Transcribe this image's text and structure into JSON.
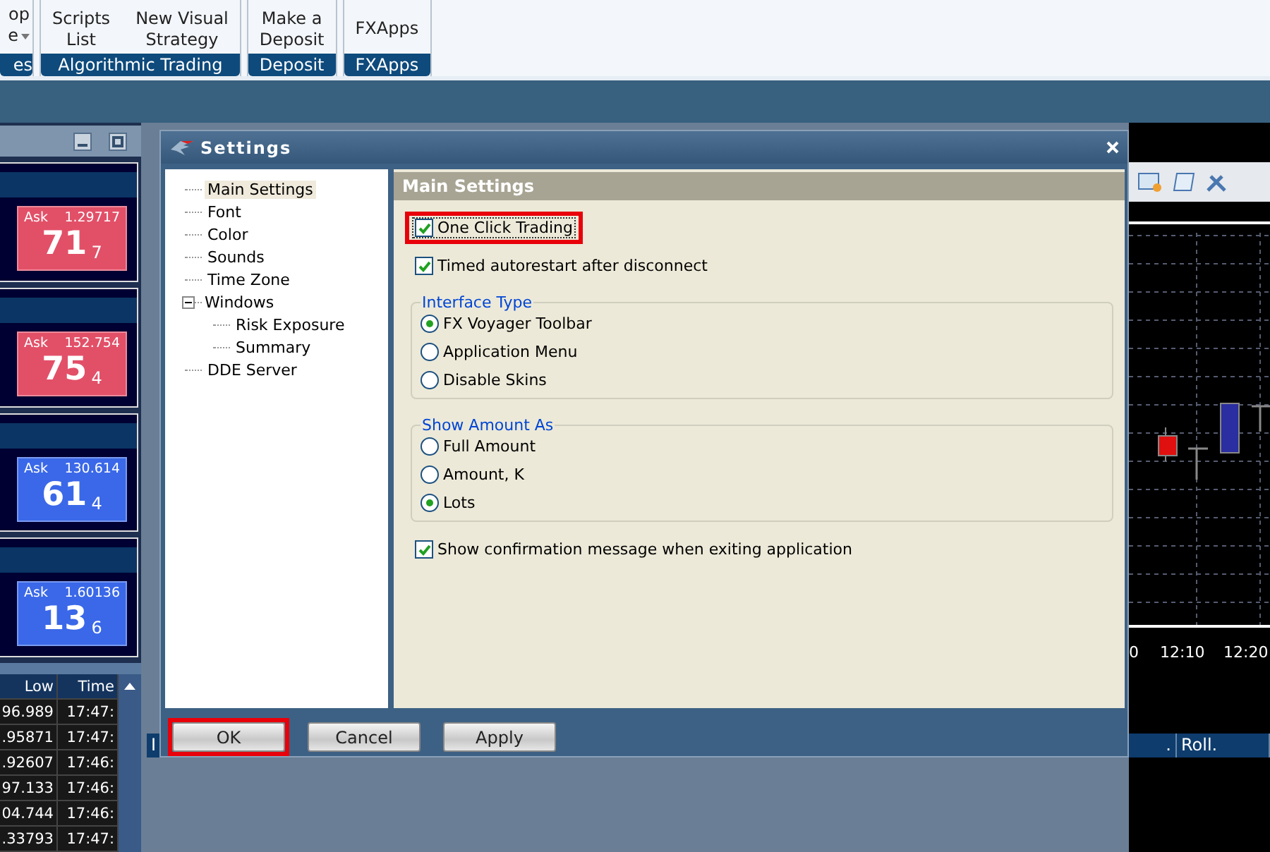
{
  "ribbon": {
    "groups": [
      {
        "label": "es",
        "buttons": [
          {
            "text": "op",
            "caret": false
          },
          {
            "text": "e",
            "caret": true
          }
        ]
      },
      {
        "label": "Algorithmic Trading",
        "buttons": [
          {
            "text": "Scripts\nList",
            "caret": false
          },
          {
            "text": "New Visual\nStrategy",
            "caret": false
          }
        ]
      },
      {
        "label": "Deposit",
        "buttons": [
          {
            "text": "Make a\nDeposit",
            "caret": false
          }
        ]
      },
      {
        "label": "FXApps",
        "buttons": [
          {
            "text": "FXApps",
            "caret": false
          }
        ]
      }
    ]
  },
  "rates": [
    {
      "side": "Ask",
      "price": "1.29717",
      "big": "71",
      "pip": "7",
      "color": "#e25068"
    },
    {
      "side": "Ask",
      "price": "152.754",
      "big": "75",
      "pip": "4",
      "color": "#e25068"
    },
    {
      "side": "Ask",
      "price": "130.614",
      "big": "61",
      "pip": "4",
      "color": "#3a68e8"
    },
    {
      "side": "Ask",
      "price": "1.60136",
      "big": "13",
      "pip": "6",
      "color": "#3a68e8"
    }
  ],
  "rates_table": {
    "columns": [
      "Low",
      "Time"
    ],
    "rows": [
      [
        "96.989",
        "17:47:"
      ],
      [
        ".95871",
        "17:47:"
      ],
      [
        ".92607",
        "17:46:"
      ],
      [
        "97.133",
        "17:46:"
      ],
      [
        "04.744",
        "17:46:"
      ],
      [
        ".33793",
        "17:47:"
      ]
    ]
  },
  "chart": {
    "x_labels": [
      "0",
      "12:10",
      "12:20"
    ]
  },
  "positions_table": {
    "columns": [
      "I",
      ".",
      "Roll."
    ]
  },
  "dialog": {
    "title": "Settings",
    "tree": [
      {
        "label": "Main Settings",
        "selected": true
      },
      {
        "label": "Font",
        "selected": false
      },
      {
        "label": "Color",
        "selected": false
      },
      {
        "label": "Sounds",
        "selected": false
      },
      {
        "label": "Time Zone",
        "selected": false
      },
      {
        "label": "Windows",
        "selected": false,
        "expanded": true,
        "children": [
          {
            "label": "Risk Exposure",
            "selected": false
          },
          {
            "label": "Summary",
            "selected": false
          }
        ]
      },
      {
        "label": "DDE Server",
        "selected": false
      }
    ],
    "section_title": "Main Settings",
    "options": [
      {
        "kind": "checkbox",
        "label": "One Click Trading",
        "checked": true,
        "highlighted": true
      },
      {
        "kind": "checkbox",
        "label": "Timed autorestart after disconnect",
        "checked": true,
        "highlighted": false
      },
      {
        "kind": "group",
        "label": "Interface Type",
        "choices": [
          {
            "label": "FX Voyager Toolbar",
            "selected": true
          },
          {
            "label": "Application Menu",
            "selected": false
          },
          {
            "label": "Disable Skins",
            "selected": false
          }
        ]
      },
      {
        "kind": "group",
        "label": "Show Amount As",
        "choices": [
          {
            "label": "Full Amount",
            "selected": false
          },
          {
            "label": "Amount, K",
            "selected": false
          },
          {
            "label": "Lots",
            "selected": true
          }
        ]
      },
      {
        "kind": "checkbox",
        "label": "Show confirmation message when exiting application",
        "checked": true,
        "highlighted": false
      }
    ],
    "buttons": [
      {
        "label": "OK",
        "highlighted": true
      },
      {
        "label": "Cancel",
        "highlighted": false
      },
      {
        "label": "Apply",
        "highlighted": false
      }
    ]
  }
}
